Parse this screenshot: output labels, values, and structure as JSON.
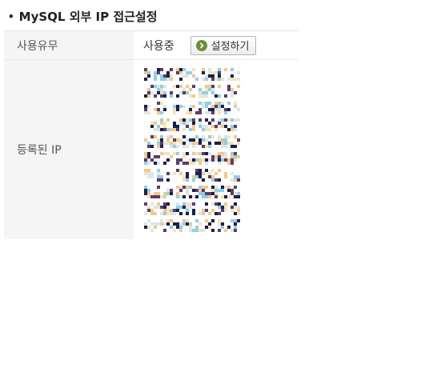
{
  "section": {
    "title": "MySQL 외부 IP 접근설정"
  },
  "settings": {
    "usage_label": "사용유무",
    "usage_value": "사용중",
    "settings_button_label": "설정하기",
    "ip_label": "등록된 IP"
  },
  "registered_ips": [
    {
      "pixelated": true
    },
    {
      "pixelated": true
    },
    {
      "pixelated": true
    },
    {
      "pixelated": true
    },
    {
      "pixelated": true
    },
    {
      "pixelated": true
    },
    {
      "pixelated": true
    },
    {
      "pixelated": true
    },
    {
      "pixelated": true
    },
    {
      "pixelated": true
    }
  ],
  "colors": {
    "button_icon": "#6b8f3a",
    "label_bg": "#f5f5f5",
    "pixel_palette": [
      "#1b1f4d",
      "#f3c98b",
      "#8fd0e8",
      "#5a3d6b",
      "#d9e7ee",
      "#f7e3b8"
    ]
  }
}
